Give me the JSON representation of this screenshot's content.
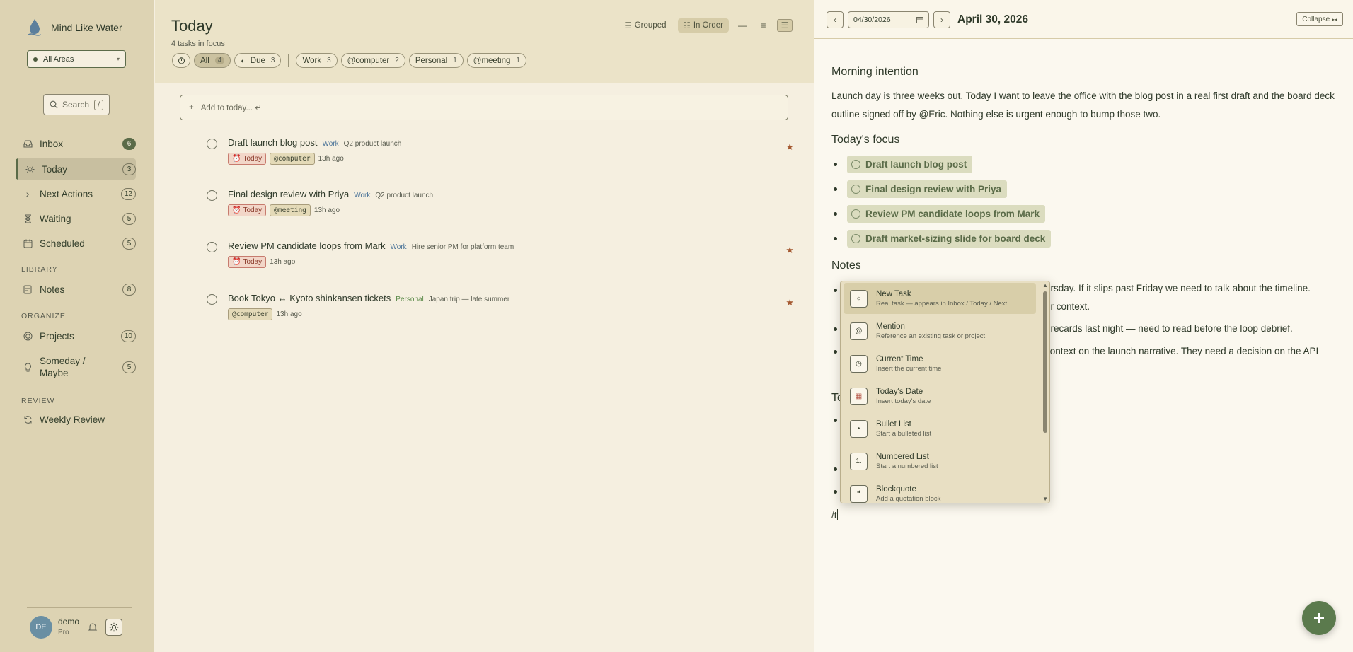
{
  "brand": {
    "name": "Mind Like Water"
  },
  "area_select": {
    "value": "All Areas"
  },
  "search": {
    "placeholder": "Search",
    "shortcut": "/"
  },
  "sidebar": {
    "items": [
      {
        "label": "Inbox",
        "count": "6",
        "icon": "inbox-icon"
      },
      {
        "label": "Today",
        "count": "3",
        "icon": "sun-icon"
      },
      {
        "label": "Next Actions",
        "count": "12",
        "icon": "chevron-right-icon"
      },
      {
        "label": "Waiting",
        "count": "5",
        "icon": "hourglass-icon"
      },
      {
        "label": "Scheduled",
        "count": "5",
        "icon": "calendar-icon"
      }
    ],
    "library_head": "LIBRARY",
    "library": [
      {
        "label": "Notes",
        "count": "8",
        "icon": "note-icon"
      }
    ],
    "organize_head": "ORGANIZE",
    "organize": [
      {
        "label": "Projects",
        "count": "10",
        "icon": "target-icon"
      },
      {
        "label": "Someday /",
        "label2": "Maybe",
        "count": "5",
        "icon": "lightbulb-icon"
      }
    ],
    "review_head": "REVIEW",
    "review": [
      {
        "label": "Weekly Review",
        "icon": "refresh-icon"
      }
    ]
  },
  "user": {
    "initials": "DE",
    "name": "demo",
    "plan": "Pro"
  },
  "main": {
    "title": "Today",
    "subtitle": "4 tasks in focus",
    "view": {
      "grouped": "Grouped",
      "in_order": "In Order"
    },
    "filters": [
      {
        "label": "All",
        "count": "4"
      },
      {
        "label": "Due",
        "count": "3"
      },
      {
        "label": "Work",
        "count": "3"
      },
      {
        "label": "@computer",
        "count": "2"
      },
      {
        "label": "Personal",
        "count": "1"
      },
      {
        "label": "@meeting",
        "count": "1"
      }
    ],
    "add_placeholder": "Add to today... ↵",
    "tasks": [
      {
        "title": "Draft launch blog post",
        "area": "Work",
        "project": "Q2 product launch",
        "today": "Today",
        "context": "@computer",
        "time": "13h ago"
      },
      {
        "title": "Final design review with Priya",
        "area": "Work",
        "project": "Q2 product launch",
        "today": "Today",
        "context": "@meeting",
        "time": "13h ago"
      },
      {
        "title": "Review PM candidate loops from Mark",
        "area": "Work",
        "project": "Hire senior PM for platform team",
        "today": "Today",
        "context": "",
        "time": "13h ago"
      },
      {
        "title": "Book Tokyo ↔ Kyoto shinkansen tickets",
        "area": "Personal",
        "project": "Japan trip — late summer",
        "today": "",
        "context": "@computer",
        "time": "13h ago"
      }
    ]
  },
  "journal": {
    "date_value": "04/30/2026",
    "date_title": "April 30, 2026",
    "collapse": "Collapse",
    "morning_heading": "Morning intention",
    "morning_text": "Launch day is three weeks out. Today I want to leave the office with the blog post in a real first draft and the board deck outline signed off by @Eric. Nothing else is urgent enough to bump those two.",
    "focus_heading": "Today's focus",
    "focus": [
      "Draft launch blog post",
      "Final design review with Priya",
      "Review PM candidate loops from Mark",
      "Draft market-sizing slide for board deck"
    ],
    "notes_heading": "Notes",
    "notes_fragments": [
      "ursday. If it slips past Friday we need to talk about the timeline.",
      "or context.",
      "orecards last night — need to read before the loop debrief.",
      "context on the launch narrative. They need a decision on the API"
    ],
    "partial_heading": "To",
    "slash_input": "/t"
  },
  "slash_menu": [
    {
      "title": "New Task",
      "desc": "Real task — appears in Inbox / Today / Next",
      "icon": "○"
    },
    {
      "title": "Mention",
      "desc": "Reference an existing task or project",
      "icon": "@"
    },
    {
      "title": "Current Time",
      "desc": "Insert the current time",
      "icon": "◷"
    },
    {
      "title": "Today's Date",
      "desc": "Insert today's date",
      "icon": "▦"
    },
    {
      "title": "Bullet List",
      "desc": "Start a bulleted list",
      "icon": "•"
    },
    {
      "title": "Numbered List",
      "desc": "Start a numbered list",
      "icon": "1."
    },
    {
      "title": "Blockquote",
      "desc": "Add a quotation block",
      "icon": "❝"
    }
  ],
  "colors": {
    "accent": "#5a6b48",
    "sidebar": "#ddd3b3",
    "fab": "#5b7a4d",
    "today_tag": "#f2d6c8"
  }
}
